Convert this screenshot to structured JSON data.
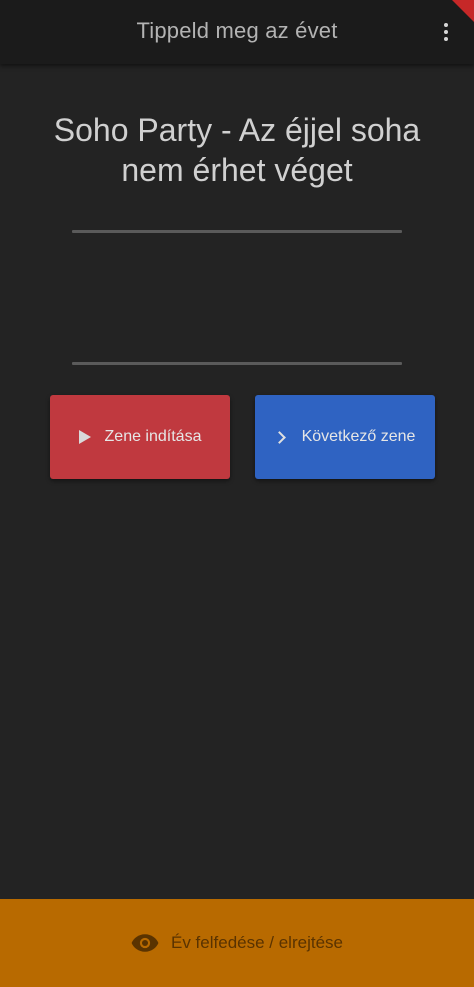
{
  "appbar": {
    "title": "Tippeld meg az évet",
    "menu_icon": "more-vert-icon"
  },
  "song": {
    "title": "Soho Party - Az éjjel soha nem érhet véget"
  },
  "buttons": {
    "play_label": "Zene indítása",
    "play_icon": "play-icon",
    "play_color": "#c0393f",
    "next_label": "Következő zene",
    "next_icon": "chevron-right-icon",
    "next_color": "#2f63c2"
  },
  "bottom": {
    "label": "Év felfedése / elrejtése",
    "icon": "eye-icon",
    "color": "#b86a00"
  }
}
